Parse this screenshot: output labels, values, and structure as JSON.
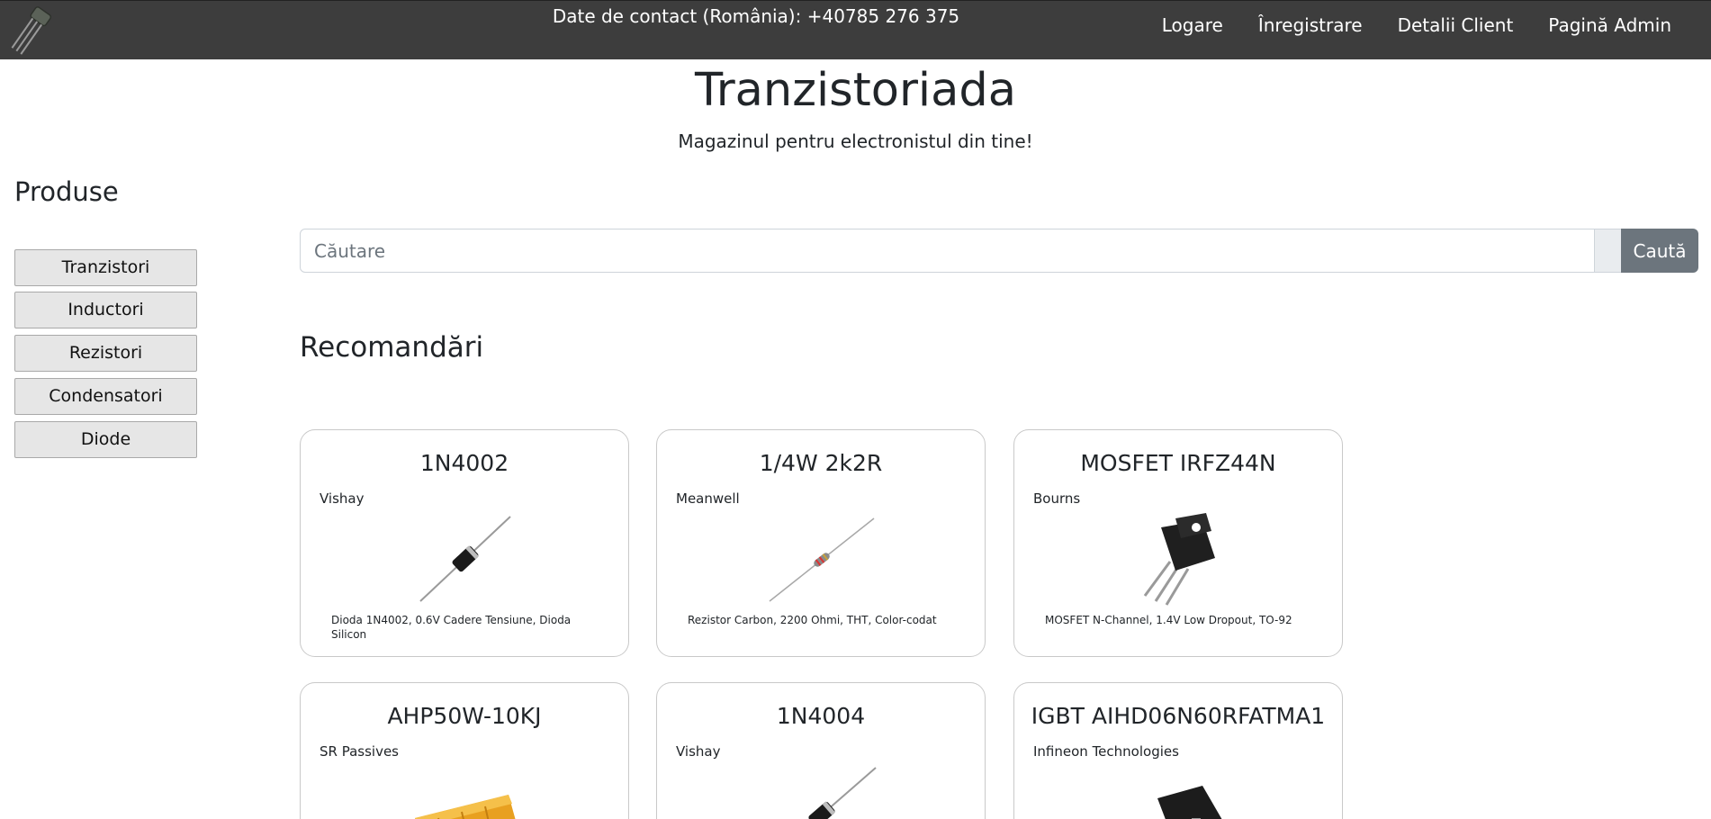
{
  "header": {
    "logo_icon": "transistor-logo-icon",
    "contact": "Date de contact (România): +40785 276 375",
    "nav": [
      {
        "label": "Logare"
      },
      {
        "label": "Înregistrare"
      },
      {
        "label": "Detalii Client"
      },
      {
        "label": "Pagină Admin"
      }
    ]
  },
  "site": {
    "title": "Tranzistoriada",
    "tagline": "Magazinul pentru electronistul din tine!"
  },
  "sidebar": {
    "title": "Produse",
    "categories": [
      {
        "label": "Tranzistori"
      },
      {
        "label": "Inductori"
      },
      {
        "label": "Rezistori"
      },
      {
        "label": "Condensatori"
      },
      {
        "label": "Diode"
      }
    ]
  },
  "search": {
    "placeholder": "Căutare",
    "value": "",
    "button_label": "Caută",
    "button_color": "#6c757d"
  },
  "recommendations": {
    "title": "Recomandări",
    "products": [
      {
        "name": "1N4002",
        "brand": "Vishay",
        "image_icon": "diode-image",
        "description": "Dioda 1N4002, 0.6V Cadere Tensiune, Dioda Silicon"
      },
      {
        "name": "1/4W 2k2R",
        "brand": "Meanwell",
        "image_icon": "resistor-image",
        "description": "Rezistor Carbon, 2200 Ohmi, THT, Color-codat"
      },
      {
        "name": "MOSFET IRFZ44N",
        "brand": "Bourns",
        "image_icon": "mosfet-image",
        "description": "MOSFET N-Channel, 1.4V Low Dropout, TO-92"
      },
      {
        "name": "AHP50W-10KJ",
        "brand": "SR Passives",
        "image_icon": "power-resistor-image",
        "description": ""
      },
      {
        "name": "1N4004",
        "brand": "Vishay",
        "image_icon": "diode-image",
        "description": ""
      },
      {
        "name": "IGBT AIHD06N60RFATMA1",
        "brand": "Infineon Technologies",
        "image_icon": "igbt-image",
        "description": ""
      }
    ]
  },
  "colors": {
    "navbar_bg": "#3d3d3d",
    "navbar_text": "#ffffff",
    "category_button_bg": "#e6e6e6",
    "card_border": "#c9c9c9"
  }
}
